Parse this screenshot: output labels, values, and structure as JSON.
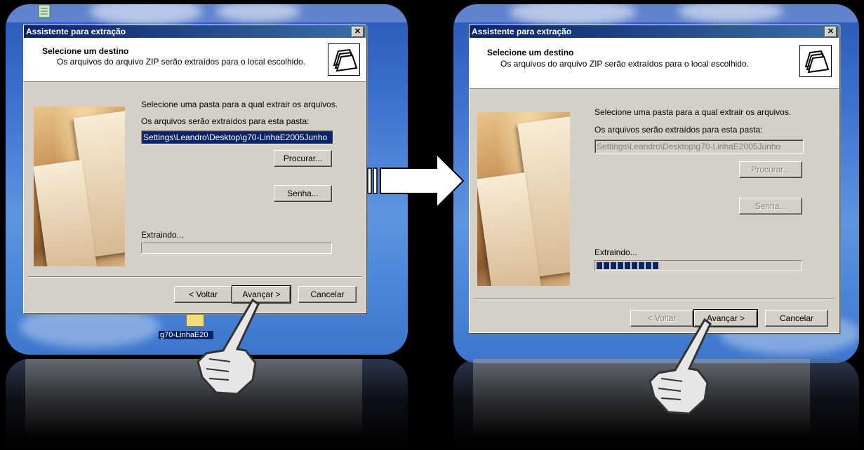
{
  "dialog_left": {
    "title": "Assistente para extração",
    "close_label": "✕",
    "header_title": "Selecione um destino",
    "header_subtitle": "Os arquivos do arquivo ZIP serão extraídos para o local escolhido.",
    "select_folder_text": "Selecione uma pasta para a qual extrair os arquivos.",
    "extract_to_label": "Os arquivos serão extraídos para esta pasta:",
    "path_value": "Settings\\Leandro\\Desktop\\g70-LinhaE2005Junho",
    "browse_label": "Procurar...",
    "password_label": "Senha...",
    "extracting_label": "Extraindo...",
    "progress": 0,
    "back_label": "< Voltar",
    "next_label": "Avançar >",
    "cancel_label": "Cancelar"
  },
  "dialog_right": {
    "title": "Assistente para extração",
    "close_label": "✕",
    "header_title": "Selecione um destino",
    "header_subtitle": "Os arquivos do arquivo ZIP serão extraídos para o local escolhido.",
    "select_folder_text": "Selecione uma pasta para a qual extrair os arquivos.",
    "extract_to_label": "Os arquivos serão extraídos para esta pasta:",
    "path_value": "Settings\\Leandro\\Desktop\\g70-LinhaE2005Junho",
    "browse_label": "Procurar...",
    "password_label": "Senha...",
    "extracting_label": "Extraindo...",
    "progress": 0.31,
    "back_label": "< Voltar",
    "next_label": "Avançar >",
    "cancel_label": "Cancelar"
  },
  "desktop_icon": {
    "label": "g70-LinhaE20"
  },
  "colors": {
    "titlebar": "#0a246a",
    "dialog_face": "#d4d0c8",
    "progress_block": "#0a246a"
  }
}
